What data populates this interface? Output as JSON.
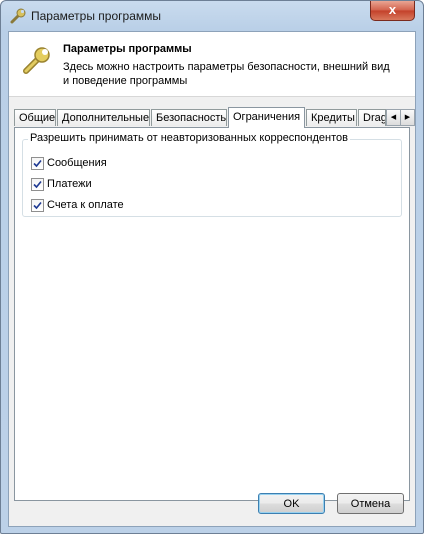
{
  "window": {
    "title": "Параметры программы",
    "close_label": "x"
  },
  "header": {
    "title": "Параметры программы",
    "description": "Здесь можно настроить параметры безопасности, внешний вид и поведение программы"
  },
  "tabs": [
    {
      "label": "Общие",
      "active": false
    },
    {
      "label": "Дополнительные",
      "active": false
    },
    {
      "label": "Безопасность",
      "active": false
    },
    {
      "label": "Ограничения",
      "active": true
    },
    {
      "label": "Кредиты",
      "active": false
    },
    {
      "label": "Drag",
      "active": false
    }
  ],
  "tab_scroll": {
    "left": "◀",
    "right": "▶"
  },
  "restrictions": {
    "group_label": "Разрешить принимать от неавторизованных корреспондентов",
    "options": [
      {
        "label": "Сообщения",
        "checked": true
      },
      {
        "label": "Платежи",
        "checked": true
      },
      {
        "label": "Счета к оплате",
        "checked": true
      }
    ]
  },
  "buttons": {
    "ok": "OK",
    "cancel": "Отмена"
  },
  "colors": {
    "title_bar": "#bcd1e8",
    "close_button": "#c34029",
    "accent_border": "#3c7fb1"
  }
}
